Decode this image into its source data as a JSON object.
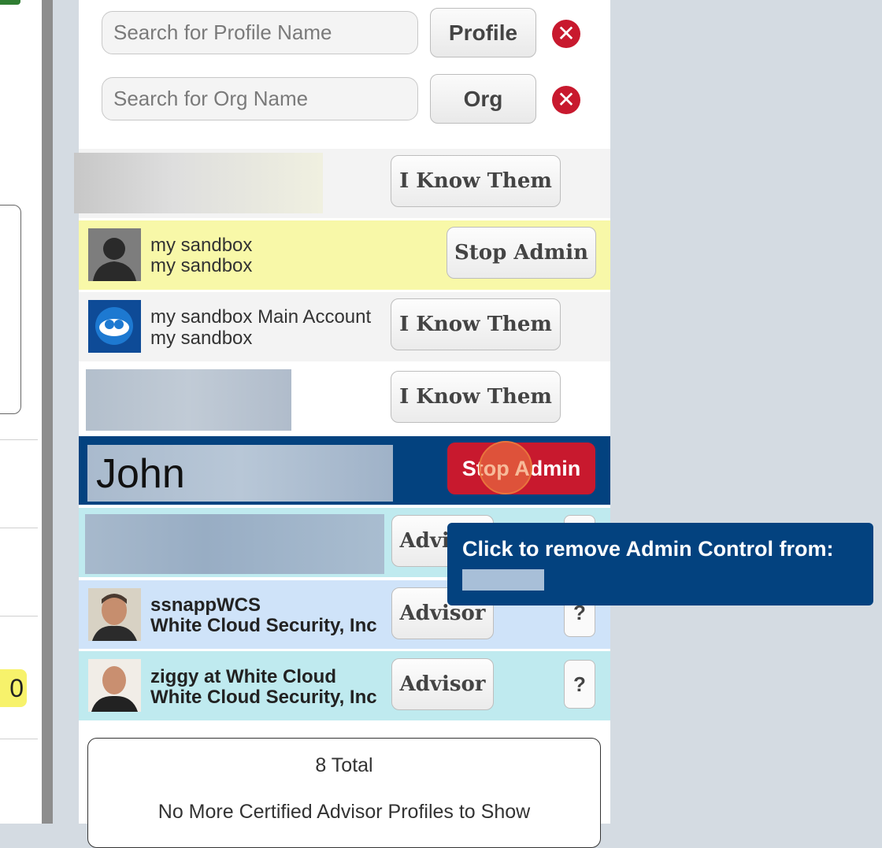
{
  "search": {
    "profile": {
      "placeholder": "Search for Profile Name",
      "button": "Profile"
    },
    "org": {
      "placeholder": "Search for Org Name",
      "button": "Org"
    },
    "clear_icon": "close-circle-icon",
    "clear_glyph": "✕"
  },
  "rows": [
    {
      "primary": "",
      "secondary": "",
      "action": "I Know Them",
      "background": "#f3f3f3"
    },
    {
      "primary": "my sandbox",
      "secondary": "my sandbox",
      "action": "Stop Admin",
      "background": "#f8f8a8"
    },
    {
      "primary": "my sandbox Main Account",
      "secondary": "my sandbox",
      "action": "I Know Them",
      "background": "#f3f3f3"
    },
    {
      "primary": "",
      "secondary": "",
      "action": "I Know Them",
      "background": "#ffffff"
    },
    {
      "primary": "John",
      "secondary": "",
      "action": "Stop Admin",
      "background": "#03427f",
      "action_color": "#c8192e"
    },
    {
      "primary": "",
      "secondary": "",
      "action": "Advisor",
      "help": "?",
      "background": "#bfeaef"
    },
    {
      "primary": "ssnappWCS",
      "secondary": "White Cloud Security, Inc",
      "action": "Advisor",
      "help": "?",
      "background": "#cfe3f9"
    },
    {
      "primary": "ziggy at White Cloud",
      "secondary": "White Cloud Security, Inc",
      "action": "Advisor",
      "help": "?",
      "background": "#bfeaef"
    }
  ],
  "summary": {
    "total": "8 Total",
    "message": "No More Certified Advisor Profiles to Show"
  },
  "tooltip": {
    "text": "Click to remove Admin Control from:"
  },
  "left": {
    "badge": "0"
  },
  "colors": {
    "accent_blue": "#03427f",
    "danger_red": "#c8192e",
    "highlight_yellow": "#f8f8a8"
  }
}
